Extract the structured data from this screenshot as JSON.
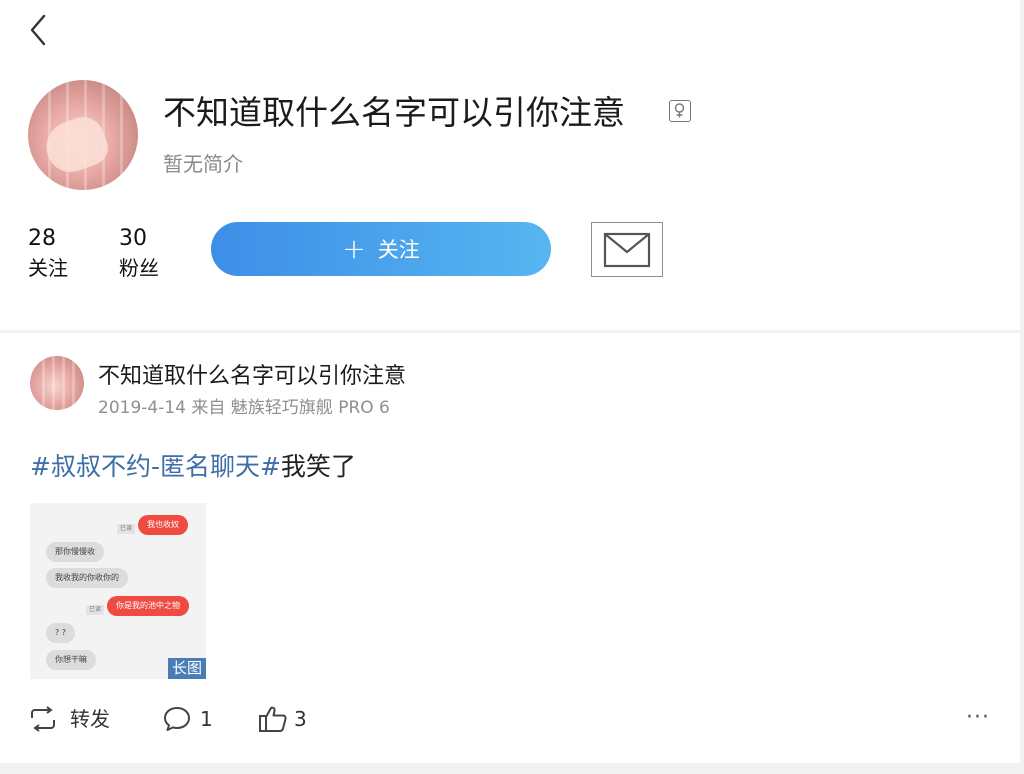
{
  "nav": {
    "back_icon": "chevron-left-icon"
  },
  "profile": {
    "username": "不知道取什么名字可以引你注意",
    "gender_icon": "female-icon",
    "bio": "暂无简介",
    "following_count": "28",
    "following_label": "关注",
    "followers_count": "30",
    "followers_label": "粉丝",
    "follow_button_label": "关注",
    "message_icon": "envelope-icon"
  },
  "post": {
    "author": "不知道取什么名字可以引你注意",
    "meta": "2019-4-14 来自 魅族轻巧旗舰 PRO 6",
    "hashtag": "#叔叔不约-匿名聊天#",
    "text": "我笑了",
    "image": {
      "badge": "长图",
      "chat": [
        {
          "side": "right",
          "text": "我也收奴",
          "read": "已读"
        },
        {
          "side": "left",
          "text": "那你慢慢收"
        },
        {
          "side": "left",
          "text": "我收我的你收你的"
        },
        {
          "side": "right",
          "text": "你是我的池中之物",
          "read": "已读"
        },
        {
          "side": "left",
          "text": "? ?"
        },
        {
          "side": "left",
          "text": "你想干嘛"
        }
      ]
    },
    "actions": {
      "repost_label": "转发",
      "comment_count": "1",
      "like_count": "3",
      "more_label": "···"
    }
  },
  "colors": {
    "accent_start": "#3d8ee7",
    "accent_end": "#57b6f0",
    "hashtag": "#3d6ea8",
    "bubble_red": "#f04b43"
  }
}
